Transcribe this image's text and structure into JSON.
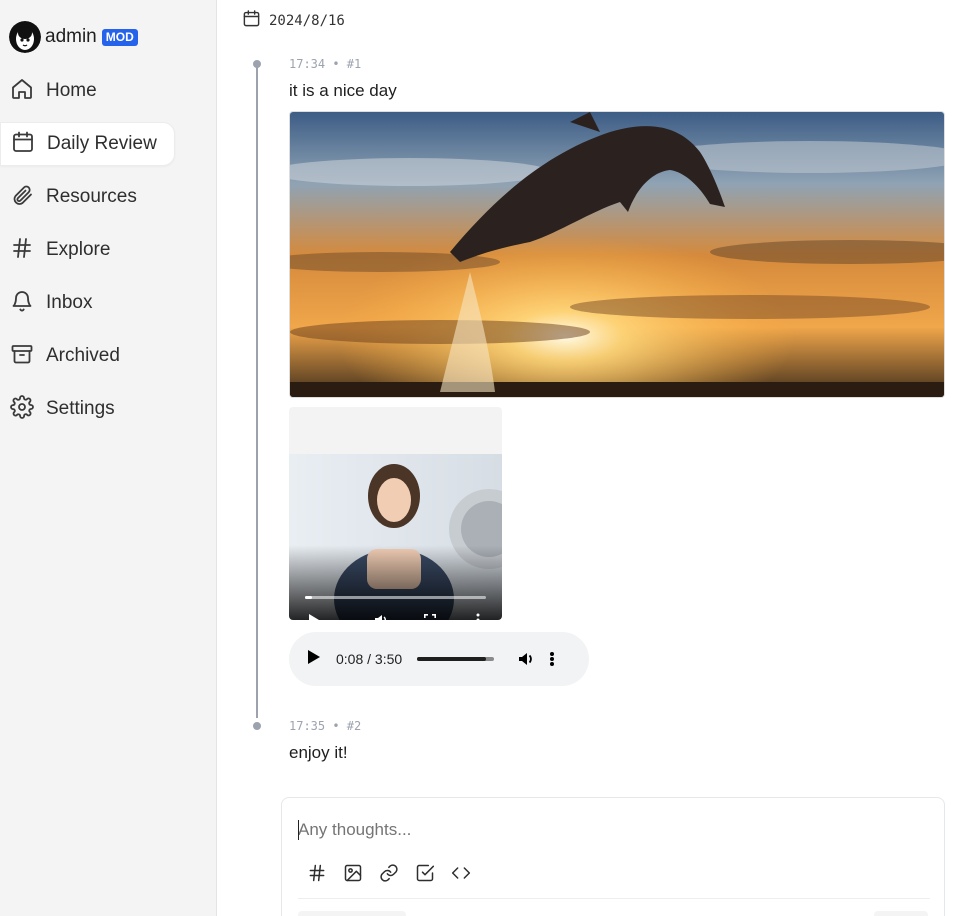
{
  "user": {
    "name": "admin",
    "badge": "MOD"
  },
  "nav": [
    {
      "label": "Home",
      "icon": "home-icon"
    },
    {
      "label": "Daily Review",
      "icon": "calendar-icon",
      "active": true
    },
    {
      "label": "Resources",
      "icon": "paperclip-icon"
    },
    {
      "label": "Explore",
      "icon": "hash-icon"
    },
    {
      "label": "Inbox",
      "icon": "bell-icon"
    },
    {
      "label": "Archived",
      "icon": "archive-icon"
    },
    {
      "label": "Settings",
      "icon": "gear-icon"
    }
  ],
  "date": "2024/8/16",
  "memos": [
    {
      "meta": "17:34 • #1",
      "text": "it is a nice day"
    },
    {
      "meta": "17:35 • #2",
      "text": "enjoy it!"
    }
  ],
  "audio": {
    "time": "0:08 / 3:50",
    "progress": 0.9
  },
  "video": {
    "progress": 0.04
  },
  "editor": {
    "placeholder": "Any thoughts..."
  },
  "colors": {
    "accent": "#2563eb",
    "sidebar_bg": "#f4f4f5",
    "timeline": "#9ca3af"
  }
}
